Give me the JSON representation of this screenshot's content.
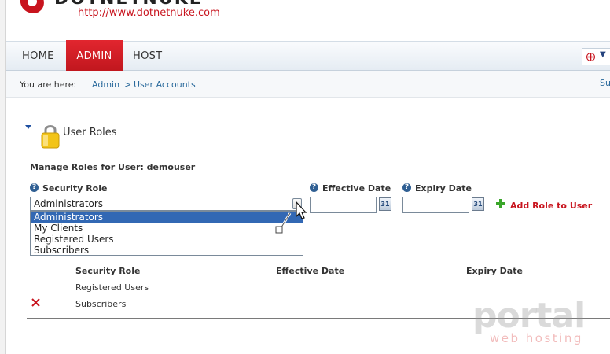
{
  "header": {
    "logo_text": "DOTNETNUKE",
    "site_url": "http://www.dotnetnuke.com"
  },
  "nav": {
    "items": [
      {
        "label": "HOME",
        "active": false
      },
      {
        "label": "ADMIN",
        "active": true
      },
      {
        "label": "HOST",
        "active": false
      }
    ],
    "language_icon": "language-flag-icon"
  },
  "breadcrumb": {
    "prefix": "You are here:",
    "items": [
      "Admin",
      "User Accounts"
    ],
    "separator": ">",
    "right_link_partial": "Su"
  },
  "module": {
    "title": "User Roles",
    "icon": "lock-icon"
  },
  "form": {
    "manage_label": "Manage Roles for User: demouser",
    "security_role_label": "Security Role",
    "effective_date_label": "Effective Date",
    "expiry_date_label": "Expiry Date",
    "selected_role": "Administrators",
    "role_options": [
      "Administrators",
      "My Clients",
      "Registered Users",
      "Subscribers"
    ],
    "effective_date_value": "",
    "expiry_date_value": "",
    "calendar_icon_text": "31",
    "add_role_label": "Add Role to User"
  },
  "table": {
    "headers": [
      "Security Role",
      "Effective Date",
      "Expiry Date"
    ],
    "rows": [
      {
        "role": "Registered Users",
        "effective": "",
        "expiry": "",
        "deletable": false
      },
      {
        "role": "Subscribers",
        "effective": "",
        "expiry": "",
        "deletable": true
      }
    ]
  },
  "watermark": {
    "brand": "portal",
    "tagline": "web hosting"
  },
  "colors": {
    "accent_red": "#c8141e",
    "link_blue": "#2a6a9c",
    "selection_blue": "#3268b4"
  }
}
